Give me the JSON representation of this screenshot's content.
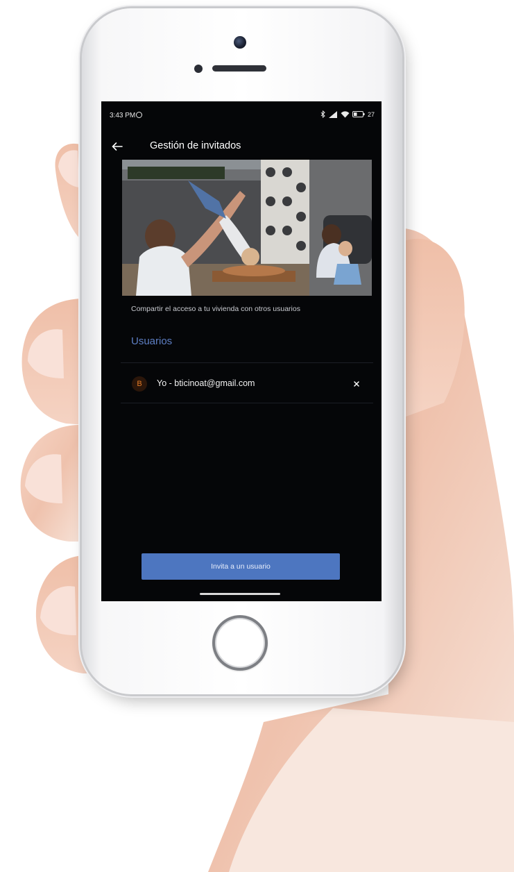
{
  "status_bar": {
    "time": "3:43 PM",
    "battery_level": "27"
  },
  "app_bar": {
    "title": "Gestión de invitados"
  },
  "content": {
    "share_description": "Compartir el acceso a tu vivienda con otros usuarios",
    "users_section_title": "Usuarios",
    "users": [
      {
        "avatar_initial": "B",
        "label": "Yo - bticinoat@gmail.com"
      }
    ]
  },
  "actions": {
    "invite_button_label": "Invita a un usuario"
  },
  "colors": {
    "accent": "#4d76c0",
    "section_title": "#5e7fc4",
    "avatar": "#e37b27",
    "screen_bg": "#050608"
  },
  "icons": [
    "back-arrow-icon",
    "alarm-icon",
    "bluetooth-icon",
    "signal-icon",
    "wifi-icon",
    "battery-icon",
    "close-icon"
  ]
}
